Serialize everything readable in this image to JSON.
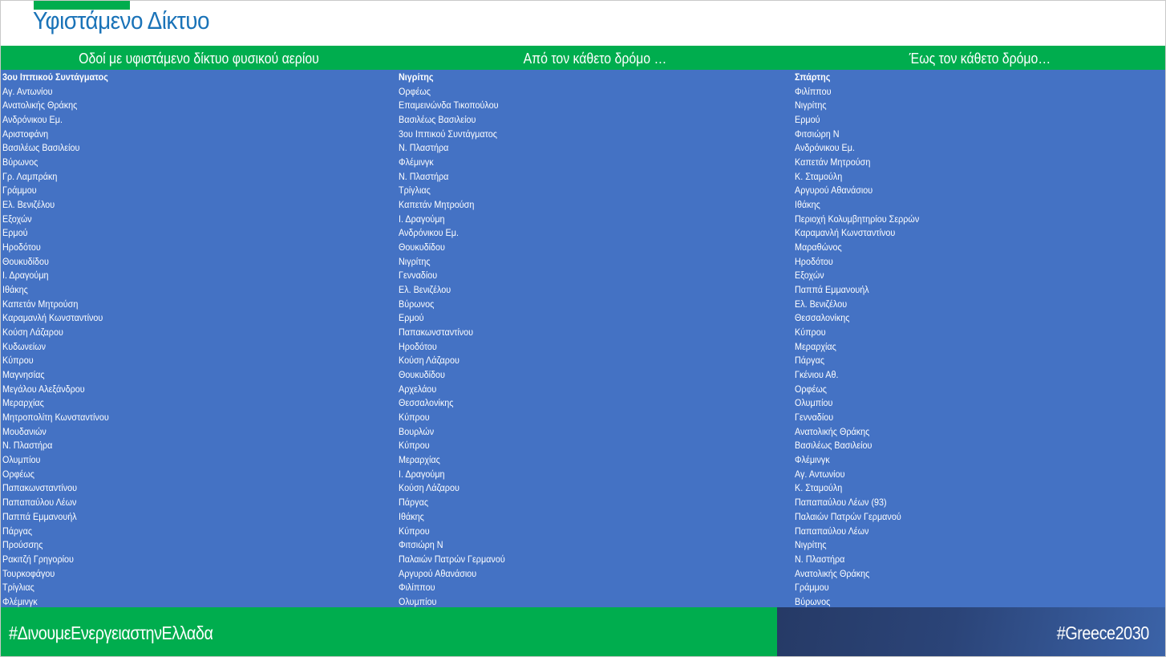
{
  "page": {
    "title": "Υφιστάμενο Δίκτυο"
  },
  "table": {
    "headers": [
      "Οδοί με υφιστάμενο δίκτυο φυσικού αερίου",
      "Από τον κάθετο δρόμο …",
      "Έως τον κάθετο δρόμο…"
    ],
    "columns": [
      [
        "3ου Ιππικού Συντάγματος",
        "Αγ. Αντωνίου",
        "Ανατολικής Θράκης",
        "Ανδρόνικου Εμ.",
        "Αριστοφάνη",
        "Βασιλέως Βασιλείου",
        "Βύρωνος",
        "Γρ. Λαμπράκη",
        "Γράμμου",
        "Ελ. Βενιζέλου",
        "Εξοχών",
        "Ερμού",
        "Ηροδότου",
        "Θουκυδίδου",
        "Ι. Δραγούμη",
        "Ιθάκης",
        "Καπετάν Μητρούση",
        "Καραμανλή Κωνσταντίνου",
        "Κούση Λάζαρου",
        "Κυδωνείων",
        "Κύπρου",
        "Μαγνησίας",
        "Μεγάλου Αλεξάνδρου",
        "Μεραρχίας",
        "Μητροπολίτη Κωνσταντίνου",
        "Μουδανιών",
        "Ν. Πλαστήρα",
        "Ολυμπίου",
        "Ορφέως",
        "Παπακωνσταντίνου",
        "Παπαπαύλου Λέων",
        "Παππά Εμμανουήλ",
        "Πάργας",
        "Προύσσης",
        "Ρακιτζή Γρηγορίου",
        "Τουρκοφάγου",
        "Τρίγλιας",
        "Φλέμινγκ"
      ],
      [
        "Νιγρίτης",
        "Ορφέως",
        "Επαμεινώνδα Τικοπούλου",
        "Βασιλέως Βασιλείου",
        "3ου Ιππικού Συντάγματος",
        "Ν. Πλαστήρα",
        "Φλέμινγκ",
        "Ν. Πλαστήρα",
        "Τρίγλιας",
        "Καπετάν Μητρούση",
        "Ι. Δραγούμη",
        "Ανδρόνικου Εμ.",
        "Θουκυδίδου",
        "Νιγρίτης",
        "Γενναδίου",
        "Ελ. Βενιζέλου",
        "Βύρωνος",
        "Ερμού",
        "Παπακωνσταντίνου",
        "Ηροδότου",
        "Κούση Λάζαρου",
        "Θουκυδίδου",
        "Αρχελάου",
        "Θεσσαλονίκης",
        "Κύπρου",
        "Βουρλών",
        "Κύπρου",
        "Μεραρχίας",
        "Ι. Δραγούμη",
        "Κούση Λάζαρου",
        "Πάργας",
        "Ιθάκης",
        "Κύπρου",
        "Φιτσιώρη Ν",
        "Παλαιών Πατρών Γερμανού",
        "Αργυρού Αθανάσιου",
        "Φιλίππου",
        "Ολυμπίου"
      ],
      [
        "Σπάρτης",
        "Φιλίππου",
        "Νιγρίτης",
        "Ερμού",
        "Φιτσιώρη Ν",
        "Ανδρόνικου Εμ.",
        "Καπετάν Μητρούση",
        "Κ. Σταμούλη",
        "Αργυρού Αθανάσιου",
        "Ιθάκης",
        "Περιοχή Κολυμβητηρίου Σερρών",
        "Καραμανλή Κωνσταντίνου",
        "Μαραθώνος",
        "Ηροδότου",
        "Εξοχών",
        "Παππά Εμμανουήλ",
        "Ελ. Βενιζέλου",
        "Θεσσαλονίκης",
        "Κύπρου",
        "Μεραρχίας",
        "Πάργας",
        "Γκένιου Αθ.",
        "Ορφέως",
        "Ολυμπίου",
        "Γενναδίου",
        "Ανατολικής Θράκης",
        "Βασιλέως Βασιλείου",
        "Φλέμινγκ",
        "Αγ. Αντωνίου",
        "Κ. Σταμούλη",
        "Παπαπαύλου Λέων (93)",
        "Παλαιών Πατρών Γερμανού",
        "Παπαπαύλου Λέων",
        "Νιγρίτης",
        "Ν. Πλαστήρα",
        "Ανατολικής Θράκης",
        "Γράμμου",
        "Βύρωνος"
      ]
    ]
  },
  "footer": {
    "hashtag": "#ΔινουμεΕνεργειαστηνΕλλαδα",
    "brand": "#Greece2030"
  },
  "colors": {
    "title_blue": "#1a73b8",
    "header_green": "#00ad4e",
    "table_blue": "#4472c4",
    "footer_navy": "#263a66"
  }
}
